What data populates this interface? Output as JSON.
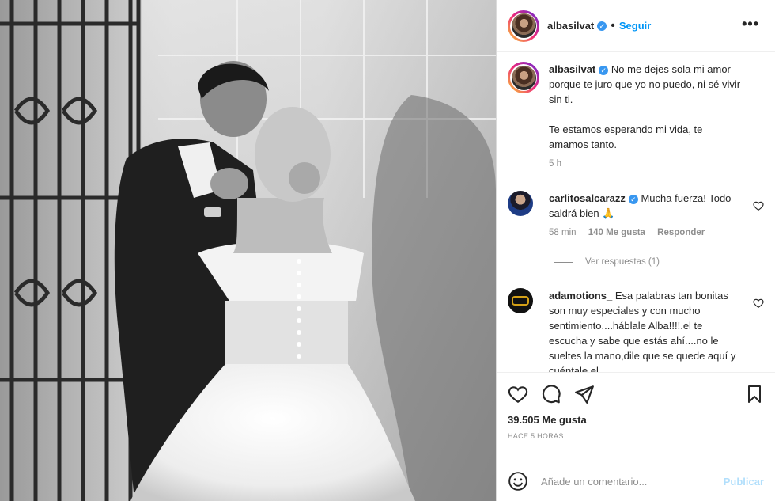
{
  "post": {
    "username": "albasilvat",
    "verified_icon": "verified-badge",
    "follow_label": "Seguir",
    "separator": "•",
    "more_label": "•••"
  },
  "caption": {
    "username": "albasilvat",
    "text1": "No me dejes sola mi amor porque te juro que yo no puedo, ni sé vivir sin ti.",
    "text2": "Te estamos esperando mi vida, te amamos tanto.",
    "time": "5 h"
  },
  "comments": [
    {
      "username": "carlitosalcarazz",
      "text": "Mucha fuerza! Todo saldrá bien 🙏",
      "time": "58 min",
      "likes": "140 Me gusta",
      "reply_label": "Responder",
      "view_replies": "Ver respuestas (1)"
    },
    {
      "username": "adamotions_",
      "text": "Esa palabras tan bonitas son muy especiales y con mucho sentimiento....háblale Alba!!!!.el te escucha y sabe que estás ahí....no le sueltes la mano,dile que se quede aquí y cuéntale el"
    }
  ],
  "footer": {
    "likes": "39.505 Me gusta",
    "ago": "HACE 5 HORAS",
    "comment_placeholder": "Añade un comentario...",
    "publish_label": "Publicar"
  },
  "colors": {
    "accent": "#0095f6",
    "muted": "#8e8e8e",
    "publish_disabled": "#b2dffc"
  }
}
